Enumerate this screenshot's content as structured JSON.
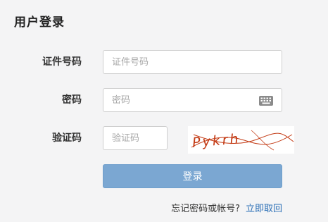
{
  "page": {
    "title": "用户登录"
  },
  "form": {
    "id_label": "证件号码",
    "id_placeholder": "证件号码",
    "password_label": "密码",
    "password_placeholder": "密码",
    "captcha_label": "验证码",
    "captcha_placeholder": "验证码",
    "captcha_image_text": "Pykrh",
    "login_button": "登录"
  },
  "footer": {
    "forgot_text": "忘记密码或帐号?",
    "recover_link": "立即取回"
  },
  "icons": {
    "keyboard": "keyboard-icon"
  },
  "colors": {
    "background": "#f4f4f5",
    "button": "#7ba7d2",
    "link": "#2b6fb6",
    "captcha_text": "#c33a14"
  }
}
